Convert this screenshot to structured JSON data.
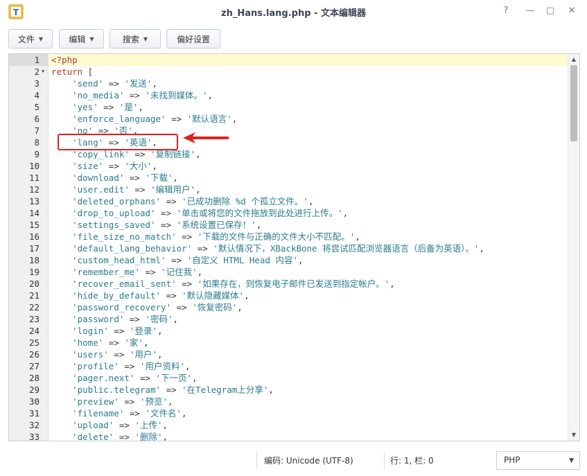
{
  "window": {
    "title": "zh_Hans.lang.php - 文本编辑器",
    "help_icon": "question-icon",
    "minimize_icon": "minimize-icon",
    "maximize_icon": "maximize-icon",
    "close_icon": "close-icon"
  },
  "toolbar": {
    "file_label": "文件",
    "edit_label": "编辑",
    "search_label": "搜索",
    "preferences_label": "偏好设置"
  },
  "editor": {
    "active_line": 1,
    "lines": [
      [
        [
          "kw",
          "<?php"
        ]
      ],
      [
        [
          "kw",
          "return"
        ],
        [
          "op",
          " ["
        ]
      ],
      [
        [
          "op",
          "    "
        ],
        [
          "str",
          "'send'"
        ],
        [
          "op",
          " => "
        ],
        [
          "str",
          "'发送'"
        ],
        [
          "op",
          ","
        ]
      ],
      [
        [
          "op",
          "    "
        ],
        [
          "str",
          "'no_media'"
        ],
        [
          "op",
          " => "
        ],
        [
          "str",
          "'未找到媒体。'"
        ],
        [
          "op",
          ","
        ]
      ],
      [
        [
          "op",
          "    "
        ],
        [
          "str",
          "'yes'"
        ],
        [
          "op",
          " => "
        ],
        [
          "str",
          "'是'"
        ],
        [
          "op",
          ","
        ]
      ],
      [
        [
          "op",
          "    "
        ],
        [
          "str",
          "'enforce_language'"
        ],
        [
          "op",
          " => "
        ],
        [
          "str",
          "'默认语言'"
        ],
        [
          "op",
          ","
        ]
      ],
      [
        [
          "op",
          "    "
        ],
        [
          "str",
          "'no'"
        ],
        [
          "op",
          " => "
        ],
        [
          "str",
          "'否'"
        ],
        [
          "op",
          ","
        ]
      ],
      [
        [
          "op",
          "    "
        ],
        [
          "str",
          "'lang'"
        ],
        [
          "op",
          " => "
        ],
        [
          "str",
          "'英语'"
        ],
        [
          "op",
          ","
        ]
      ],
      [
        [
          "op",
          "    "
        ],
        [
          "str",
          "'copy_link'"
        ],
        [
          "op",
          " => "
        ],
        [
          "str",
          "'复制链接'"
        ],
        [
          "op",
          ","
        ]
      ],
      [
        [
          "op",
          "    "
        ],
        [
          "str",
          "'size'"
        ],
        [
          "op",
          " => "
        ],
        [
          "str",
          "'大小'"
        ],
        [
          "op",
          ","
        ]
      ],
      [
        [
          "op",
          "    "
        ],
        [
          "str",
          "'download'"
        ],
        [
          "op",
          " => "
        ],
        [
          "str",
          "'下载'"
        ],
        [
          "op",
          ","
        ]
      ],
      [
        [
          "op",
          "    "
        ],
        [
          "str",
          "'user.edit'"
        ],
        [
          "op",
          " => "
        ],
        [
          "str",
          "'编辑用户'"
        ],
        [
          "op",
          ","
        ]
      ],
      [
        [
          "op",
          "    "
        ],
        [
          "str",
          "'deleted_orphans'"
        ],
        [
          "op",
          " => "
        ],
        [
          "str",
          "'已成功删除 %d 个孤立文件。'"
        ],
        [
          "op",
          ","
        ]
      ],
      [
        [
          "op",
          "    "
        ],
        [
          "str",
          "'drop_to_upload'"
        ],
        [
          "op",
          " => "
        ],
        [
          "str",
          "'单击或将您的文件拖放到此处进行上传。'"
        ],
        [
          "op",
          ","
        ]
      ],
      [
        [
          "op",
          "    "
        ],
        [
          "str",
          "'settings_saved'"
        ],
        [
          "op",
          " => "
        ],
        [
          "str",
          "'系统设置已保存！'"
        ],
        [
          "op",
          ","
        ]
      ],
      [
        [
          "op",
          "    "
        ],
        [
          "str",
          "'file_size_no_match'"
        ],
        [
          "op",
          " => "
        ],
        [
          "str",
          "'下载的文件与正确的文件大小不匹配。'"
        ],
        [
          "op",
          ","
        ]
      ],
      [
        [
          "op",
          "    "
        ],
        [
          "str",
          "'default_lang_behavior'"
        ],
        [
          "op",
          " => "
        ],
        [
          "str",
          "'默认情况下，XBackBone 将尝试匹配浏览器语言（后备为英语）。'"
        ],
        [
          "op",
          ","
        ]
      ],
      [
        [
          "op",
          "    "
        ],
        [
          "str",
          "'custom_head_html'"
        ],
        [
          "op",
          " => "
        ],
        [
          "str",
          "'自定义 HTML Head 内容'"
        ],
        [
          "op",
          ","
        ]
      ],
      [
        [
          "op",
          "    "
        ],
        [
          "str",
          "'remember_me'"
        ],
        [
          "op",
          " => "
        ],
        [
          "str",
          "'记住我'"
        ],
        [
          "op",
          ","
        ]
      ],
      [
        [
          "op",
          "    "
        ],
        [
          "str",
          "'recover_email_sent'"
        ],
        [
          "op",
          " => "
        ],
        [
          "str",
          "'如果存在，则恢复电子邮件已发送到指定帐户。'"
        ],
        [
          "op",
          ","
        ]
      ],
      [
        [
          "op",
          "    "
        ],
        [
          "str",
          "'hide_by_default'"
        ],
        [
          "op",
          " => "
        ],
        [
          "str",
          "'默认隐藏媒体'"
        ],
        [
          "op",
          ","
        ]
      ],
      [
        [
          "op",
          "    "
        ],
        [
          "str",
          "'password_recovery'"
        ],
        [
          "op",
          " => "
        ],
        [
          "str",
          "'恢复密码'"
        ],
        [
          "op",
          ","
        ]
      ],
      [
        [
          "op",
          "    "
        ],
        [
          "str",
          "'password'"
        ],
        [
          "op",
          " => "
        ],
        [
          "str",
          "'密码'"
        ],
        [
          "op",
          ","
        ]
      ],
      [
        [
          "op",
          "    "
        ],
        [
          "str",
          "'login'"
        ],
        [
          "op",
          " => "
        ],
        [
          "str",
          "'登录'"
        ],
        [
          "op",
          ","
        ]
      ],
      [
        [
          "op",
          "    "
        ],
        [
          "str",
          "'home'"
        ],
        [
          "op",
          " => "
        ],
        [
          "str",
          "'家'"
        ],
        [
          "op",
          ","
        ]
      ],
      [
        [
          "op",
          "    "
        ],
        [
          "str",
          "'users'"
        ],
        [
          "op",
          " => "
        ],
        [
          "str",
          "'用户'"
        ],
        [
          "op",
          ","
        ]
      ],
      [
        [
          "op",
          "    "
        ],
        [
          "str",
          "'profile'"
        ],
        [
          "op",
          " => "
        ],
        [
          "str",
          "'用户资料'"
        ],
        [
          "op",
          ","
        ]
      ],
      [
        [
          "op",
          "    "
        ],
        [
          "str",
          "'pager.next'"
        ],
        [
          "op",
          " => "
        ],
        [
          "str",
          "'下一页'"
        ],
        [
          "op",
          ","
        ]
      ],
      [
        [
          "op",
          "    "
        ],
        [
          "str",
          "'public.telegram'"
        ],
        [
          "op",
          " => "
        ],
        [
          "str",
          "'在Telegram上分享'"
        ],
        [
          "op",
          ","
        ]
      ],
      [
        [
          "op",
          "    "
        ],
        [
          "str",
          "'preview'"
        ],
        [
          "op",
          " => "
        ],
        [
          "str",
          "'预览'"
        ],
        [
          "op",
          ","
        ]
      ],
      [
        [
          "op",
          "    "
        ],
        [
          "str",
          "'filename'"
        ],
        [
          "op",
          " => "
        ],
        [
          "str",
          "'文件名'"
        ],
        [
          "op",
          ","
        ]
      ],
      [
        [
          "op",
          "    "
        ],
        [
          "str",
          "'upload'"
        ],
        [
          "op",
          " => "
        ],
        [
          "str",
          "'上传'"
        ],
        [
          "op",
          ","
        ]
      ],
      [
        [
          "op",
          "    "
        ],
        [
          "str",
          "'delete'"
        ],
        [
          "op",
          " => "
        ],
        [
          "str",
          "'删除'"
        ],
        [
          "op",
          ","
        ]
      ]
    ]
  },
  "statusbar": {
    "encoding": "编码: Unicode (UTF-8)",
    "position": "行: 1, 栏: 0",
    "language": "PHP"
  },
  "colors": {
    "keyword": "#b03a2e",
    "string": "#2a7b8c",
    "annotation": "#e02020",
    "active_line_bg": "#fffbd1"
  }
}
